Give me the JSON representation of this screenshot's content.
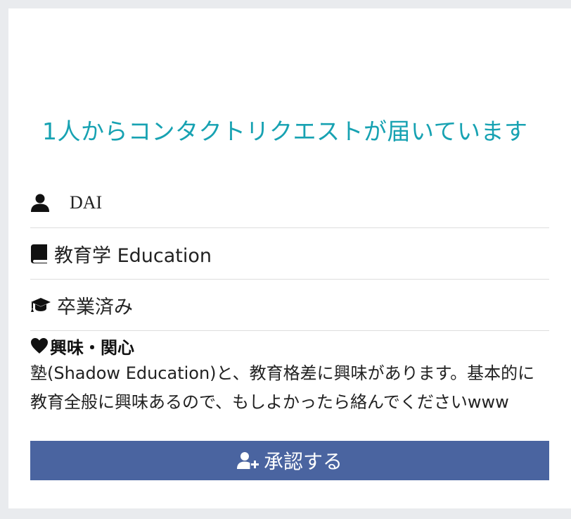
{
  "request": {
    "title": "1人からコンタクトリクエストが届いています"
  },
  "profile": {
    "name": "DAI",
    "major": "教育学 Education",
    "status": "卒業済み",
    "interest_label": "興味・関心",
    "interest_text": "塾(Shadow Education)と、教育格差に興味があります。基本的に教育全般に興味あるので、もしよかったら絡んでくださいwww"
  },
  "actions": {
    "approve_label": "承認する"
  },
  "icons": {
    "name": "user-icon",
    "major": "book-icon",
    "status": "graduation-cap-icon",
    "interest": "heart-icon",
    "approve": "user-plus-icon"
  },
  "colors": {
    "title": "#17a2b2",
    "button": "#4a64a0",
    "background": "#e9ebee"
  }
}
